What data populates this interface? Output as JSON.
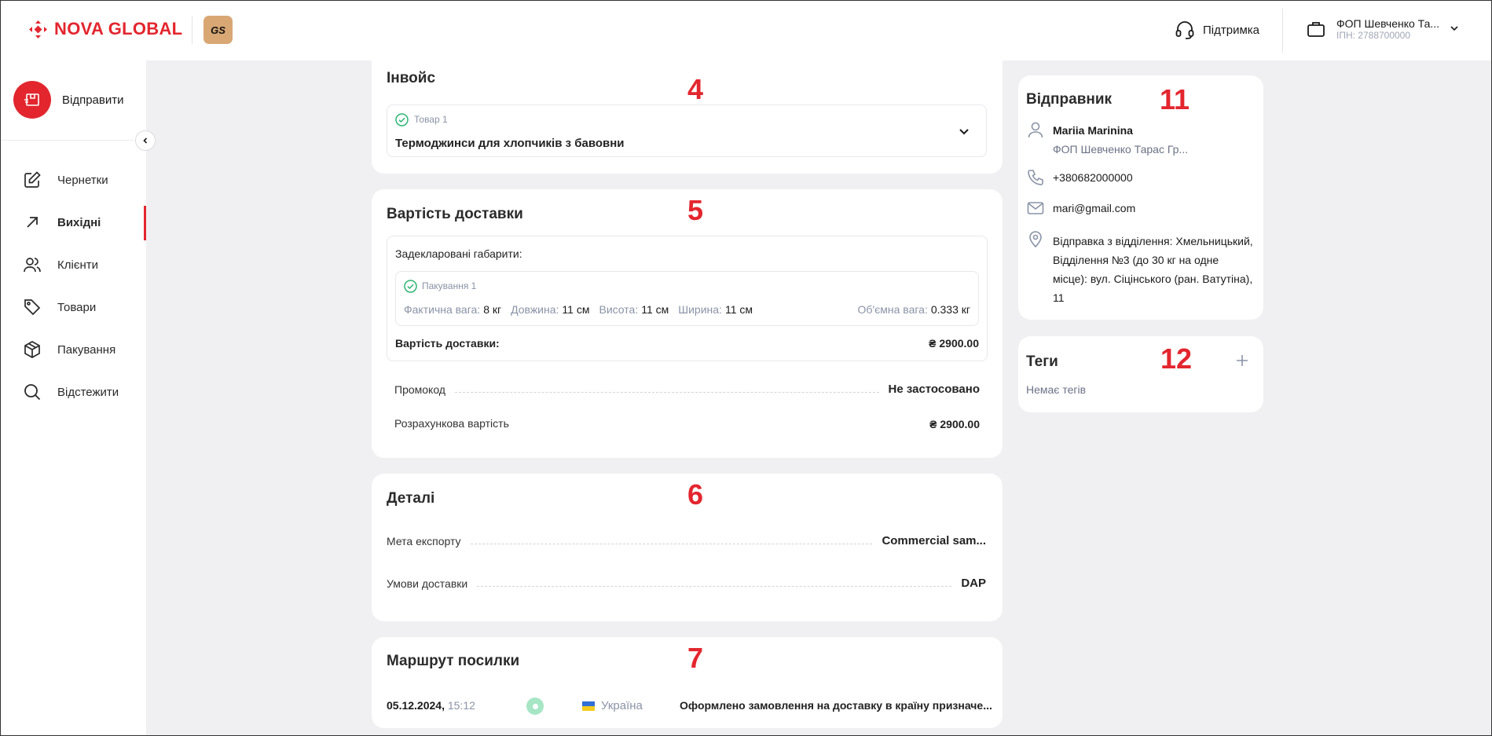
{
  "header": {
    "logo_text": "NOVA GLOBAL",
    "badge": "GS",
    "support_label": "Підтримка",
    "account_name": "ФОП Шевченко Та...",
    "account_inn": "ІПН: 2788700000"
  },
  "sidebar": {
    "send_label": "Відправити",
    "items": [
      {
        "label": "Чернетки",
        "icon": "edit-icon"
      },
      {
        "label": "Вихідні",
        "icon": "arrow-up-right-icon",
        "active": true
      },
      {
        "label": "Клієнти",
        "icon": "users-icon"
      },
      {
        "label": "Товари",
        "icon": "tag-icon"
      },
      {
        "label": "Пакування",
        "icon": "box-icon"
      },
      {
        "label": "Відстежити",
        "icon": "search-icon"
      }
    ]
  },
  "invoice": {
    "title": "Інвойс",
    "annotation": "4",
    "item_label": "Товар 1",
    "item_name": "Термоджинси для хлопчиків з бавовни"
  },
  "delivery": {
    "title": "Вартість доставки",
    "annotation": "5",
    "declared_label": "Задекларовані габарити:",
    "package_label": "Пакування 1",
    "weight_label": "Фактична вага:",
    "weight_value": "8 кг",
    "length_label": "Довжина:",
    "length_value": "11 см",
    "height_label": "Висота:",
    "height_value": "11 см",
    "width_label": "Ширина:",
    "width_value": "11 см",
    "volume_label": "Об'ємна вага:",
    "volume_value": "0.333 кг",
    "cost_label": "Вартість доставки:",
    "cost_value": "₴ 2900.00",
    "promo_label": "Промокод",
    "promo_value": "Не застосовано",
    "estimated_label": "Розрахункова вартість",
    "estimated_value": "₴ 2900.00"
  },
  "details": {
    "title": "Деталі",
    "annotation": "6",
    "purpose_label": "Мета експорту",
    "purpose_value": "Commercial sam...",
    "terms_label": "Умови доставки",
    "terms_value": "DAP"
  },
  "route": {
    "title": "Маршрут посилки",
    "annotation": "7",
    "date": "05.12.2024,",
    "time": "15:12",
    "country": "Україна",
    "status": "Оформлено замовлення на доставку в країну призначе..."
  },
  "sender": {
    "title": "Відправник",
    "annotation": "11",
    "name": "Mariia Marinina",
    "company": "ФОП Шевченко Тарас Гр...",
    "phone": "+380682000000",
    "email": "mari@gmail.com",
    "address_line1": "Відправка з відділення: Хмельницький,",
    "address_line2": "Відділення №3 (до 30 кг на одне",
    "address_line3": "місце): вул. Сіцінського (ран. Ватутіна),",
    "address_line4": "11"
  },
  "tags": {
    "title": "Теги",
    "annotation": "12",
    "empty_text": "Немає тегів"
  },
  "colors": {
    "brand_red": "#e3262e",
    "status_green": "#2bb673",
    "muted": "#8a93a6"
  }
}
